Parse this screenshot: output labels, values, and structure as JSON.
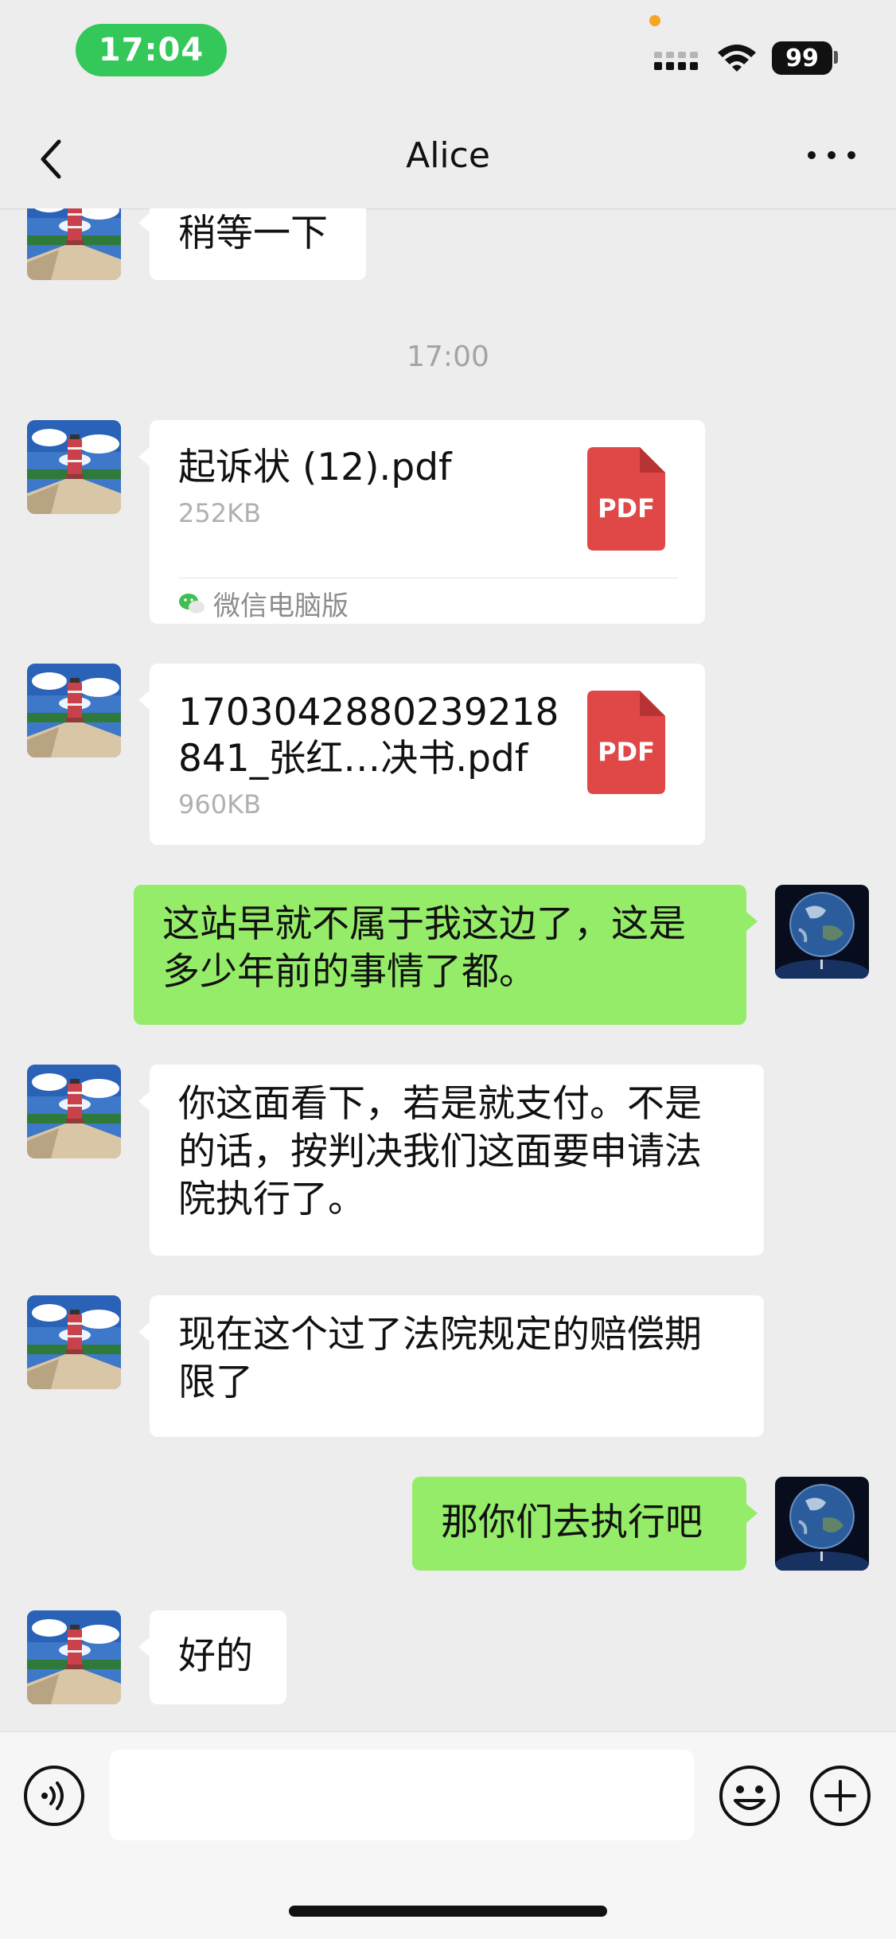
{
  "status_bar": {
    "time": "17:04",
    "battery": "99"
  },
  "nav": {
    "title": "Alice",
    "back_icon": "chevron-left-icon",
    "more_icon": "more-dots-icon"
  },
  "messages": [
    {
      "from": "contact",
      "type": "text",
      "text": "稍等一下"
    },
    {
      "type": "timestamp",
      "text": "17:00"
    },
    {
      "from": "contact",
      "type": "file",
      "name": "起诉状 (12).pdf",
      "size": "252KB",
      "badge": "PDF",
      "source": "微信电脑版"
    },
    {
      "from": "contact",
      "type": "file",
      "name_line1": "1703042880239218",
      "name_line2": "841_张红…决书.pdf",
      "size": "960KB",
      "badge": "PDF"
    },
    {
      "from": "me",
      "type": "text",
      "line1": "这站早就不属于我这边了，这是",
      "line2": "多少年前的事情了都。"
    },
    {
      "from": "contact",
      "type": "text",
      "line1": "你这面看下，若是就支付。不是",
      "line2": "的话，按判决我们这面要申请法",
      "line3": "院执行了。"
    },
    {
      "from": "contact",
      "type": "text",
      "line1": "现在这个过了法院规定的赔偿期",
      "line2": "限了"
    },
    {
      "from": "me",
      "type": "text",
      "text": "那你们去执行吧"
    },
    {
      "from": "contact",
      "type": "text",
      "text": "好的"
    }
  ],
  "input_bar": {
    "value": "",
    "voice_icon": "voice-icon",
    "emoji_icon": "emoji-icon",
    "plus_icon": "plus-icon"
  },
  "colors": {
    "my_bubble": "#95ec69",
    "contact_bubble": "#ffffff",
    "background": "#ededed",
    "time_pill": "#34c759",
    "pdf": "#e04848"
  }
}
